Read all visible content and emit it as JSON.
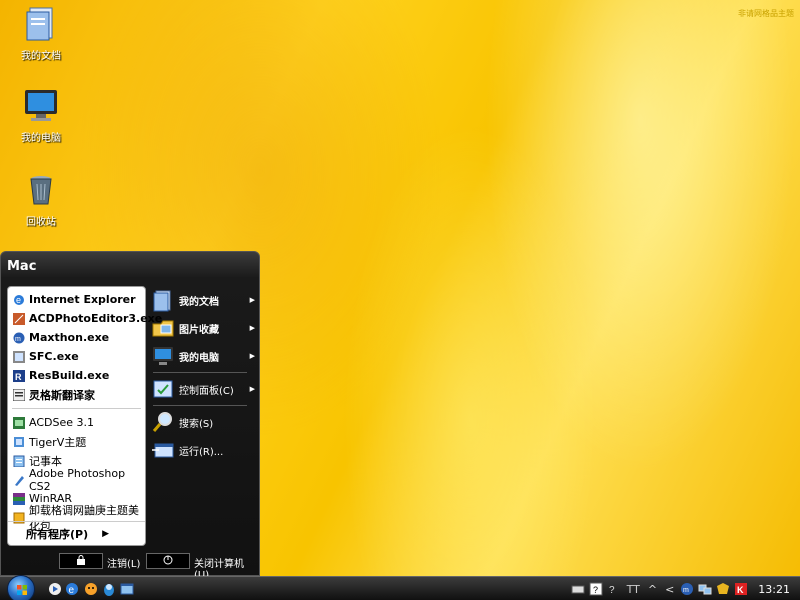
{
  "watermark": "非请网格品主题",
  "desktop_icons": [
    {
      "label": "我的文档",
      "icon": "my-documents-icon"
    },
    {
      "label": "我的电脑",
      "icon": "my-computer-icon"
    },
    {
      "label": "回收站",
      "icon": "recycle-bin-icon"
    }
  ],
  "start_menu": {
    "user_name": "Mac",
    "pinned": [
      {
        "label": "Internet Explorer",
        "icon": "internet-explorer-icon"
      },
      {
        "label": "ACDPhotoEditor3.exe",
        "icon": "acd-photo-editor-icon"
      },
      {
        "label": "Maxthon.exe",
        "icon": "maxthon-icon"
      },
      {
        "label": "SFC.exe",
        "icon": "sfc-icon"
      },
      {
        "label": "ResBuild.exe",
        "icon": "resbuild-icon"
      },
      {
        "label": "灵格斯翻译家",
        "icon": "lingoes-icon"
      }
    ],
    "recent": [
      {
        "label": "ACDSee 3.1",
        "icon": "acdsee-icon"
      },
      {
        "label": "TigerV主题",
        "icon": "tigerv-icon"
      },
      {
        "label": "记事本",
        "icon": "notepad-icon"
      },
      {
        "label": "Adobe Photoshop CS2",
        "icon": "photoshop-icon"
      },
      {
        "label": "WinRAR",
        "icon": "winrar-icon"
      },
      {
        "label": "卸载格调网鼬庚主题美化包",
        "icon": "uninstall-icon"
      }
    ],
    "all_programs": "所有程序(P)",
    "right_items": [
      {
        "label": "我的文档",
        "icon": "documents-icon"
      },
      {
        "label": "图片收藏",
        "icon": "pictures-icon"
      },
      {
        "label": "我的电脑",
        "icon": "computer-icon"
      },
      {
        "label": "控制面板(C)",
        "icon": "control-panel-icon"
      },
      {
        "label": "搜索(S)",
        "icon": "search-icon"
      },
      {
        "label": "运行(R)...",
        "icon": "run-icon"
      }
    ],
    "logoff_label": "注销(L)",
    "shutdown_label": "关闭计算机(U)"
  },
  "taskbar": {
    "tray_text": "TT",
    "clock": "13:21"
  }
}
